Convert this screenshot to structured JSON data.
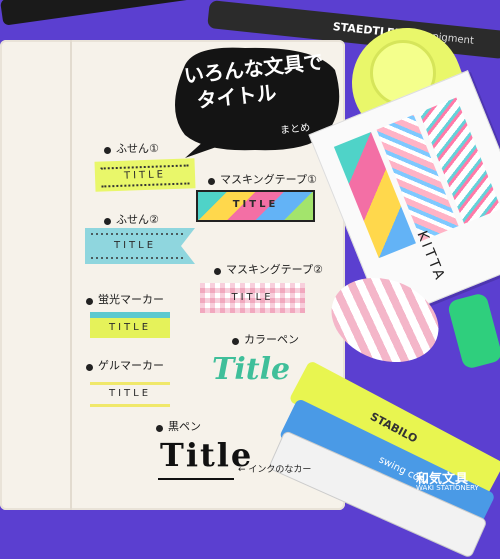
{
  "bubble": {
    "title_line1": "いろんな文具で",
    "title_line2": "タイトル",
    "subtitle": "まとめ"
  },
  "items": [
    {
      "label": "ふせん①",
      "tag": "TITLE"
    },
    {
      "label": "マスキングテープ①",
      "tag": "TITLE"
    },
    {
      "label": "ふせん②",
      "tag": "TITLE"
    },
    {
      "label": "マスキングテープ②",
      "tag": "TITLE"
    },
    {
      "label": "蛍光マーカー",
      "tag": "TITLE"
    },
    {
      "label": "カラーペン",
      "tag": "Title"
    },
    {
      "label": "ゲルマーカー",
      "tag": "TITLE"
    },
    {
      "label": "黒ペン",
      "tag": "Title"
    }
  ],
  "note": "← インクのなカー",
  "products": {
    "staedtler_brand": "STAEDTLER",
    "staedtler_model": "pigment",
    "kitta": "KITTA",
    "stabilo": "STABILO",
    "swing_cool": "swing cool"
  },
  "logo": {
    "brand": "和気文具",
    "sub": "WAKI STATIONERY"
  },
  "colors": {
    "background": "#5b3fd0",
    "paper": "#f6f2ea",
    "bubble": "#141414",
    "yellow": "#e9f76a",
    "teal": "#8fd6de",
    "pink": "#f4b6c9"
  }
}
